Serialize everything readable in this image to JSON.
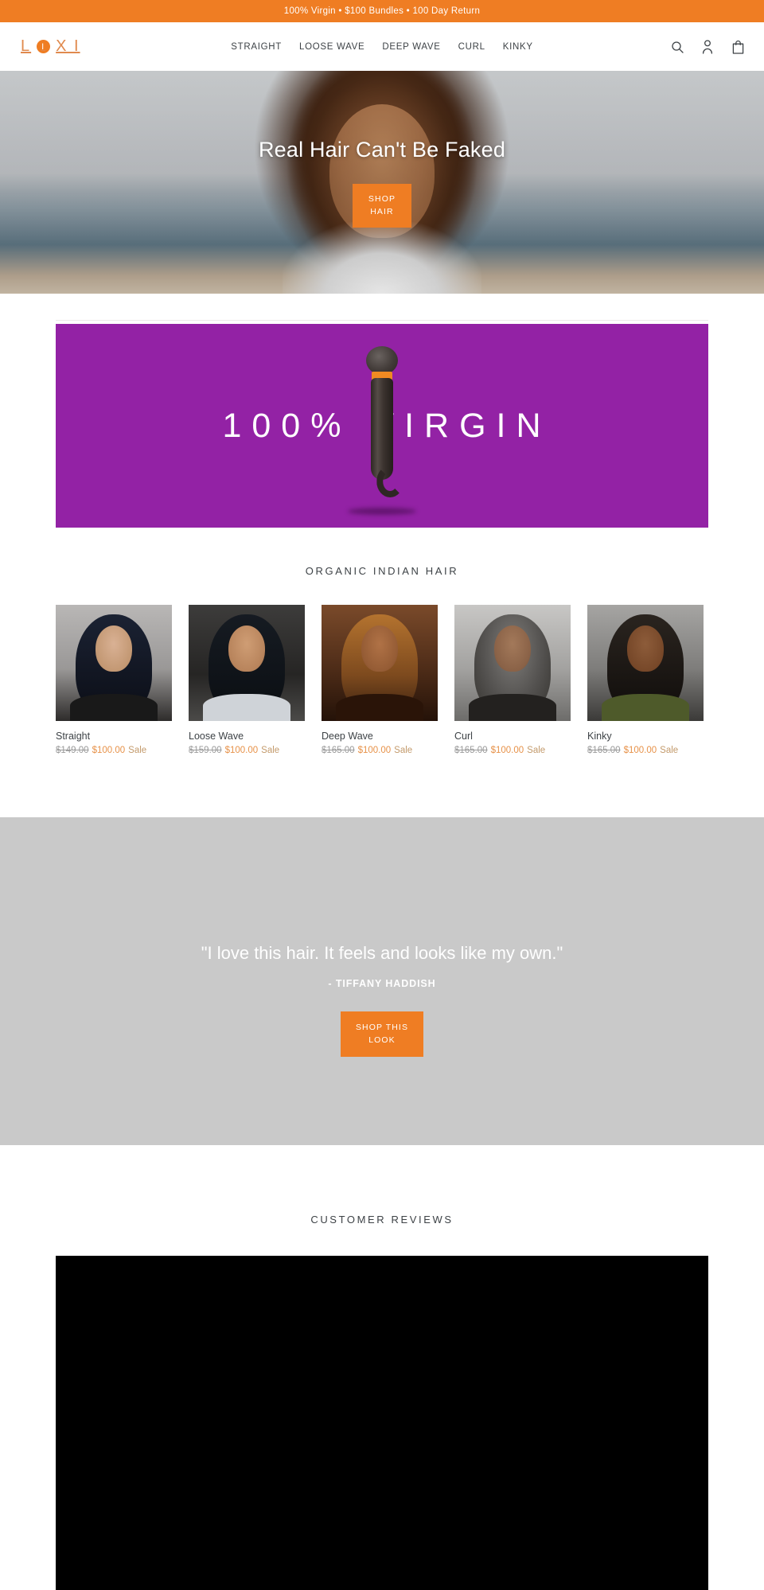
{
  "announcement": {
    "text": "100% Virgin • $100 Bundles • 100 Day Return"
  },
  "header": {
    "logo": {
      "pre": "L",
      "dot": "I",
      "post": "X I",
      "full": "LOXI"
    },
    "nav": [
      {
        "label": "STRAIGHT"
      },
      {
        "label": "LOOSE WAVE"
      },
      {
        "label": "DEEP WAVE"
      },
      {
        "label": "CURL"
      },
      {
        "label": "KINKY"
      }
    ],
    "icons": [
      {
        "name": "search-icon",
        "label": "Search"
      },
      {
        "name": "account-icon",
        "label": "Log in"
      },
      {
        "name": "cart-icon",
        "label": "Cart"
      }
    ]
  },
  "hero": {
    "title": "Real Hair Can't Be Faked",
    "cta": "SHOP HAIR"
  },
  "banner": {
    "text": "100% VIRGIN"
  },
  "products_section": {
    "title": "ORGANIC INDIAN HAIR",
    "items": [
      {
        "name": "Straight",
        "old_price": "$149.00",
        "new_price": "$100.00",
        "tag": "Sale"
      },
      {
        "name": "Loose Wave",
        "old_price": "$159.00",
        "new_price": "$100.00",
        "tag": "Sale"
      },
      {
        "name": "Deep Wave",
        "old_price": "$165.00",
        "new_price": "$100.00",
        "tag": "Sale"
      },
      {
        "name": "Curl",
        "old_price": "$165.00",
        "new_price": "$100.00",
        "tag": "Sale"
      },
      {
        "name": "Kinky",
        "old_price": "$165.00",
        "new_price": "$100.00",
        "tag": "Sale"
      }
    ]
  },
  "testimonial": {
    "quote": "\"I love this hair. It feels and looks like my own.\"",
    "attribution": "- TIFFANY HADDISH",
    "cta": "SHOP THIS LOOK"
  },
  "reviews": {
    "title": "CUSTOMER REVIEWS"
  },
  "colors": {
    "accent_orange": "#ef7d23",
    "banner_purple": "#9322a5",
    "testimonial_gray": "#c9c9c9",
    "sale_price": "#e79249",
    "text": "#3d4246"
  }
}
